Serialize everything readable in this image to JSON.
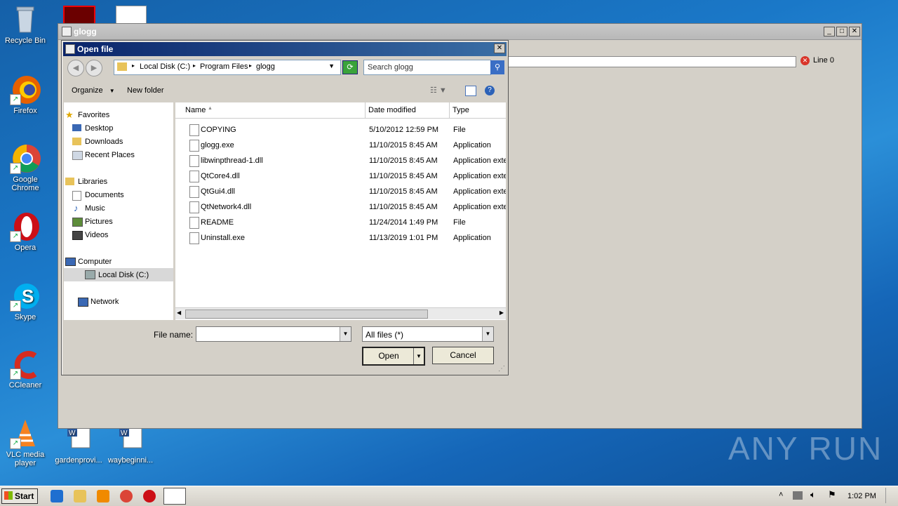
{
  "desktop": {
    "icons": [
      {
        "label": "Recycle Bin"
      },
      {
        "label": "Firefox"
      },
      {
        "label": "Google Chrome"
      },
      {
        "label": "Opera"
      },
      {
        "label": "Skype"
      },
      {
        "label": "CCleaner"
      },
      {
        "label": "VLC media player"
      },
      {
        "label": "gardenprovi..."
      },
      {
        "label": "waybeginni..."
      }
    ],
    "watermark": "ANY RUN"
  },
  "glogg_window": {
    "title": "glogg",
    "line_status": "Line 0"
  },
  "open_dialog": {
    "title": "Open file",
    "breadcrumb": [
      "Local Disk (C:)",
      "Program Files",
      "glogg"
    ],
    "search_placeholder": "Search glogg",
    "toolbar": {
      "organize": "Organize",
      "new_folder": "New folder"
    },
    "nav": {
      "favorites": "Favorites",
      "favorites_items": [
        "Desktop",
        "Downloads",
        "Recent Places"
      ],
      "libraries": "Libraries",
      "libraries_items": [
        "Documents",
        "Music",
        "Pictures",
        "Videos"
      ],
      "computer": "Computer",
      "computer_items": [
        "Local Disk (C:)"
      ],
      "network": "Network"
    },
    "columns": {
      "name": "Name",
      "date": "Date modified",
      "type": "Type"
    },
    "files": [
      {
        "name": "COPYING",
        "date": "5/10/2012 12:59 PM",
        "type": "File"
      },
      {
        "name": "glogg.exe",
        "date": "11/10/2015 8:45 AM",
        "type": "Application"
      },
      {
        "name": "libwinpthread-1.dll",
        "date": "11/10/2015 8:45 AM",
        "type": "Application exte"
      },
      {
        "name": "QtCore4.dll",
        "date": "11/10/2015 8:45 AM",
        "type": "Application exte"
      },
      {
        "name": "QtGui4.dll",
        "date": "11/10/2015 8:45 AM",
        "type": "Application exte"
      },
      {
        "name": "QtNetwork4.dll",
        "date": "11/10/2015 8:45 AM",
        "type": "Application exte"
      },
      {
        "name": "README",
        "date": "11/24/2014 1:49 PM",
        "type": "File"
      },
      {
        "name": "Uninstall.exe",
        "date": "11/13/2019 1:01 PM",
        "type": "Application"
      }
    ],
    "file_name_label": "File name:",
    "file_name_value": "",
    "filter_value": "All files (*)",
    "open_label": "Open",
    "cancel_label": "Cancel"
  },
  "taskbar": {
    "start_label": "Start",
    "clock": "1:02 PM"
  }
}
